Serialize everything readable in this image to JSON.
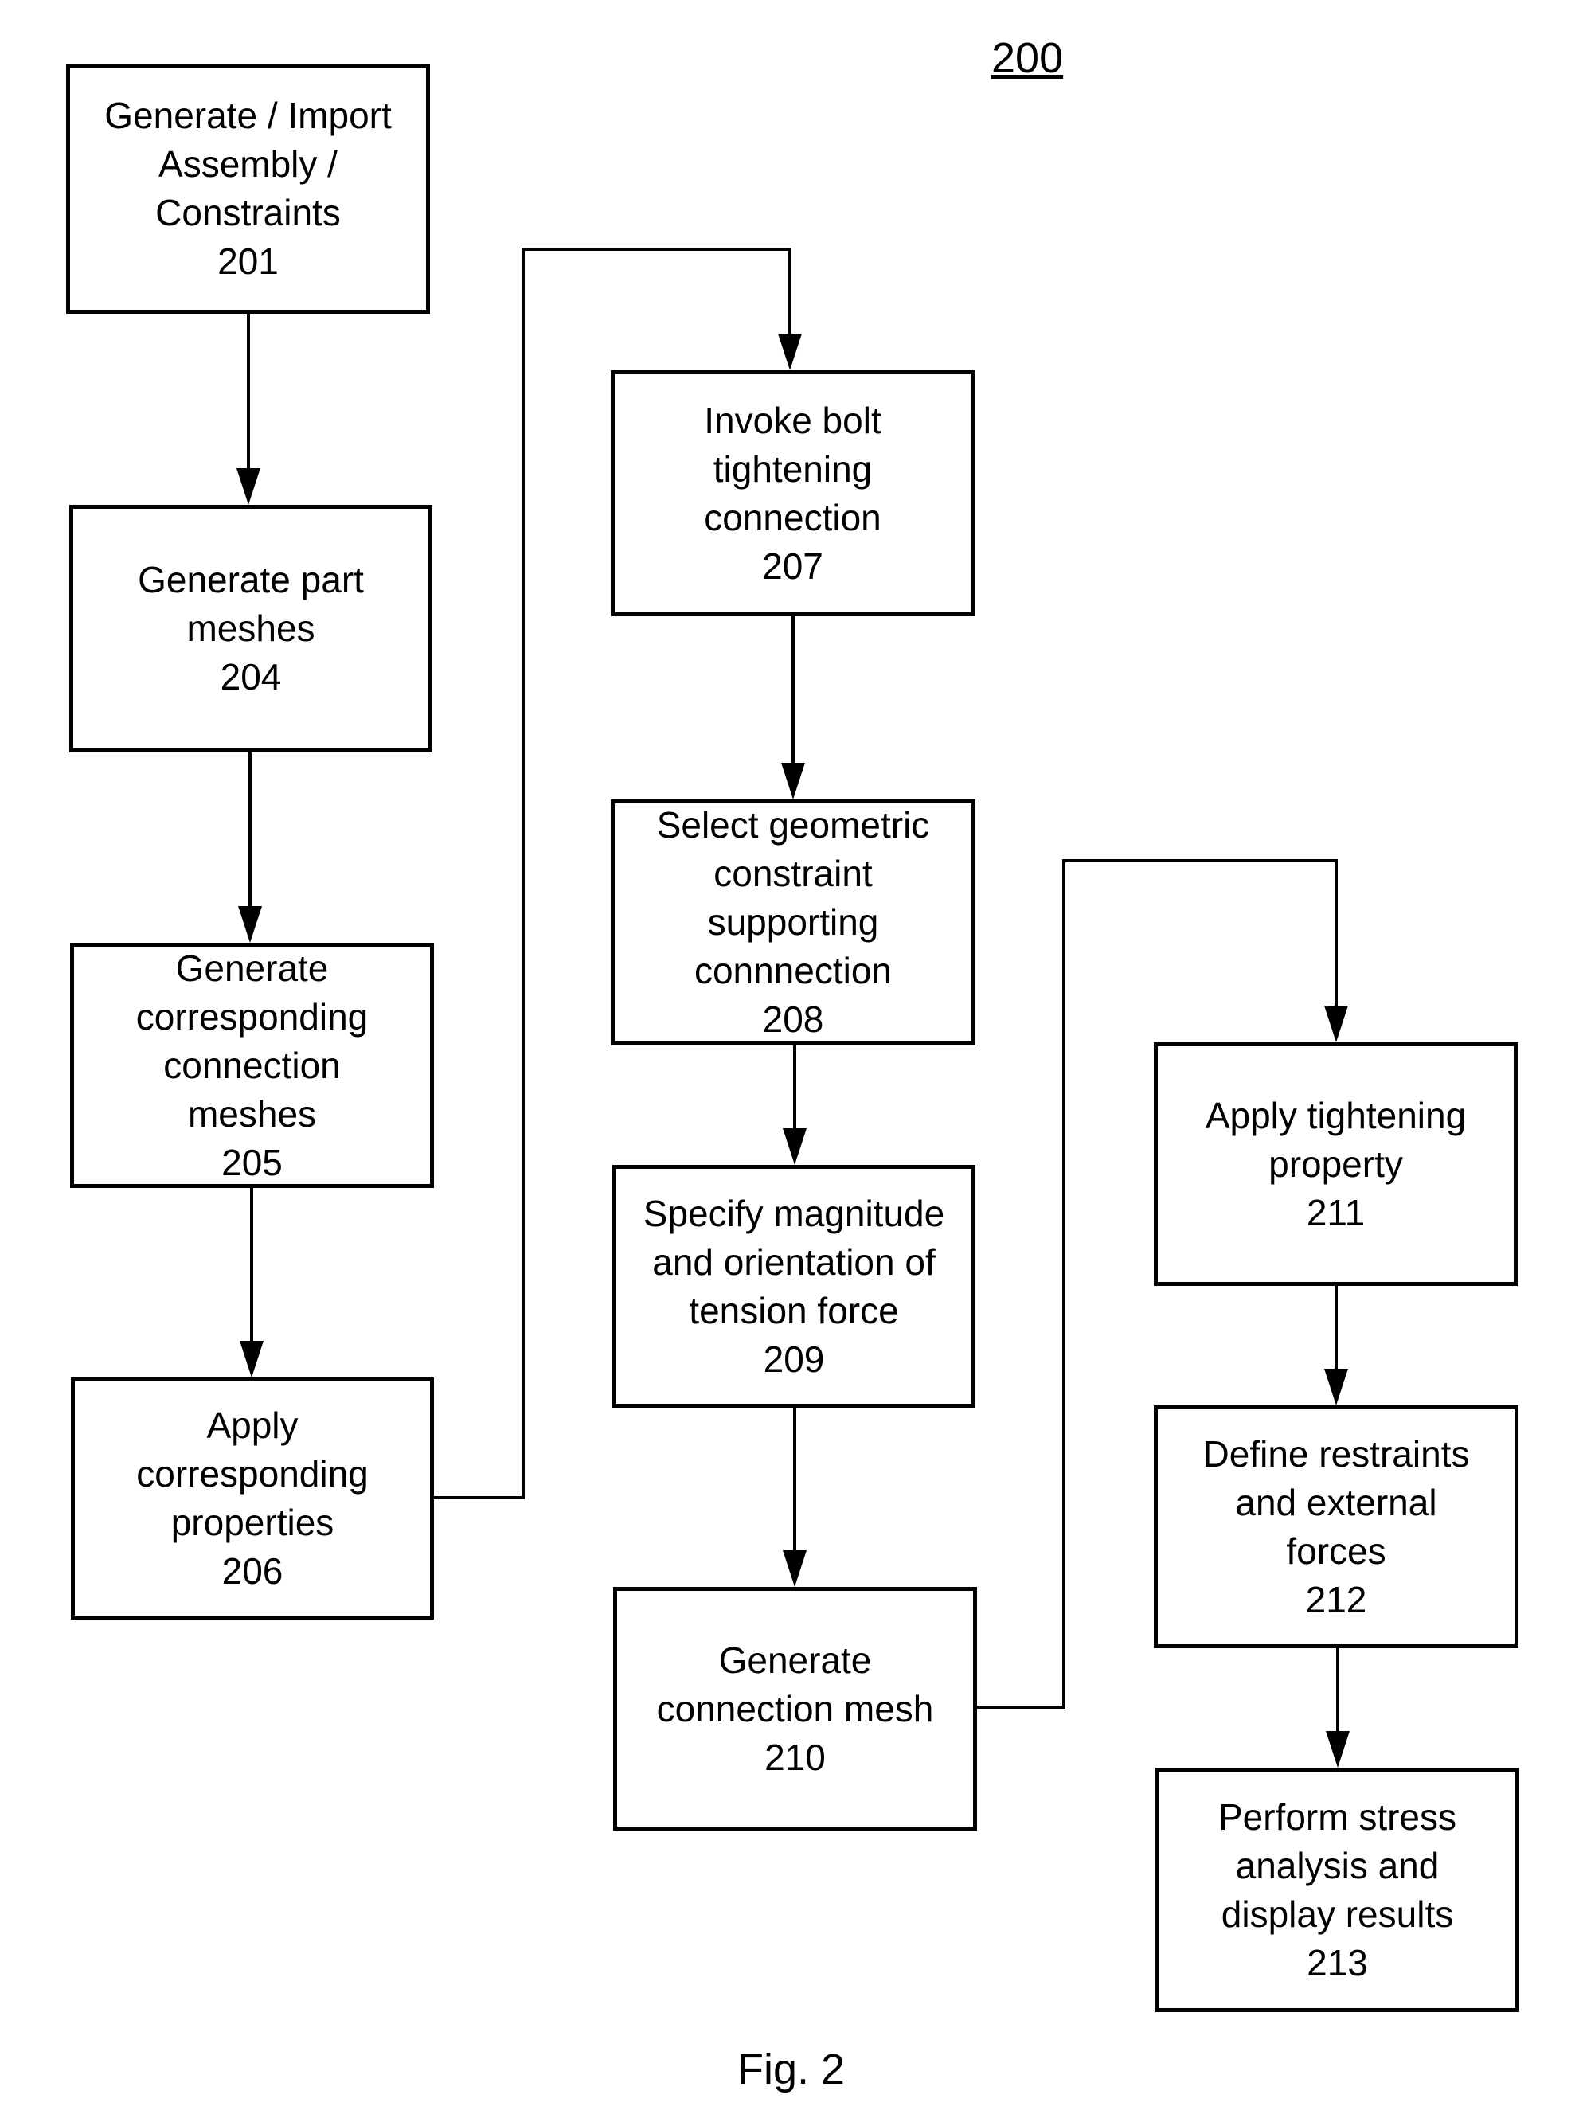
{
  "figure": {
    "number": "200",
    "caption": "Fig. 2"
  },
  "steps": {
    "s201": {
      "label": "Generate / Import\nAssembly /\nConstraints",
      "ref": "201"
    },
    "s204": {
      "label": "Generate part\nmeshes",
      "ref": "204"
    },
    "s205": {
      "label": "Generate\ncorresponding\nconnection\nmeshes",
      "ref": "205"
    },
    "s206": {
      "label": "Apply\ncorresponding\nproperties",
      "ref": "206"
    },
    "s207": {
      "label": "Invoke bolt\ntightening\nconnection",
      "ref": "207"
    },
    "s208": {
      "label": "Select geometric\nconstraint\nsupporting\nconnnection",
      "ref": "208"
    },
    "s209": {
      "label": "Specify magnitude\nand orientation of\ntension force",
      "ref": "209"
    },
    "s210": {
      "label": "Generate\nconnection mesh",
      "ref": "210"
    },
    "s211": {
      "label": "Apply tightening\nproperty",
      "ref": "211"
    },
    "s212": {
      "label": "Define restraints\nand external\nforces",
      "ref": "212"
    },
    "s213": {
      "label": "Perform stress\nanalysis and\ndisplay results",
      "ref": "213"
    }
  },
  "flow": [
    [
      "201",
      "204"
    ],
    [
      "204",
      "205"
    ],
    [
      "205",
      "206"
    ],
    [
      "206",
      "207"
    ],
    [
      "207",
      "208"
    ],
    [
      "208",
      "209"
    ],
    [
      "209",
      "210"
    ],
    [
      "210",
      "211"
    ],
    [
      "211",
      "212"
    ],
    [
      "212",
      "213"
    ]
  ]
}
